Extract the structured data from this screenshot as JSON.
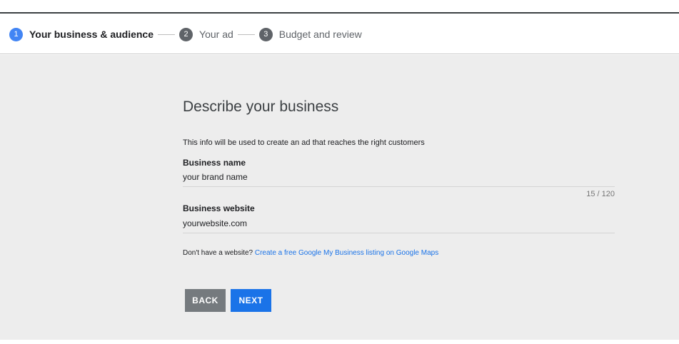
{
  "stepper": {
    "steps": [
      {
        "number": "1",
        "label": "Your business & audience"
      },
      {
        "number": "2",
        "label": "Your ad"
      },
      {
        "number": "3",
        "label": "Budget and review"
      }
    ]
  },
  "form": {
    "title": "Describe your business",
    "subtitle": "This info will be used to create an ad that reaches the right customers",
    "business_name": {
      "label": "Business name",
      "value": "your brand name",
      "counter": "15 / 120"
    },
    "business_website": {
      "label": "Business website",
      "value": "yourwebsite.com"
    },
    "help": {
      "text": "Don't have a website?",
      "link": "Create a free Google My Business listing on Google Maps"
    },
    "back_label": "BACK",
    "next_label": "NEXT"
  },
  "colors": {
    "active_step": "#4285f4",
    "inactive_step": "#5f6368",
    "primary_button": "#1a73e8",
    "secondary_button": "#757a7e",
    "link": "#1a73e8",
    "background": "#ededed"
  }
}
